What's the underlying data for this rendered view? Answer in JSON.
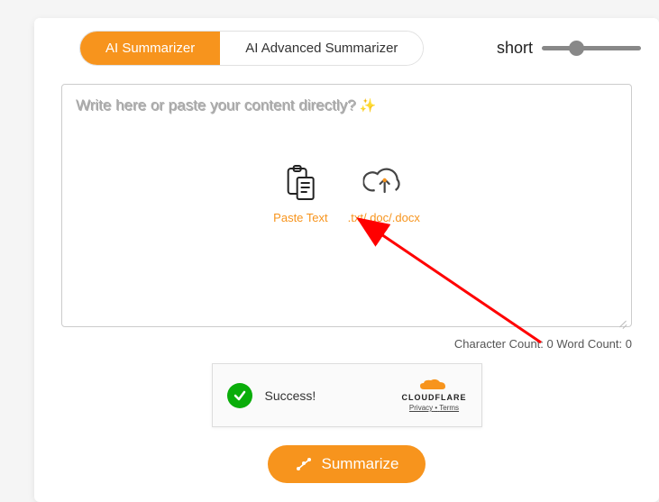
{
  "tabs": {
    "ai_summarizer": "AI Summarizer",
    "ai_advanced": "AI Advanced Summarizer"
  },
  "slider": {
    "left_label": "short"
  },
  "textarea": {
    "placeholder": "Write here or paste your content directly?"
  },
  "actions": {
    "paste_label": "Paste Text",
    "upload_label": ".txt/.doc/.docx"
  },
  "counts": {
    "char_label": "Character Count:",
    "char_value": "0",
    "word_label": "Word Count:",
    "word_value": "0"
  },
  "captcha": {
    "success": "Success!",
    "brand": "CLOUDFLARE",
    "privacy": "Privacy",
    "dot": "•",
    "terms": "Terms"
  },
  "summarize": {
    "label": "Summarize"
  }
}
